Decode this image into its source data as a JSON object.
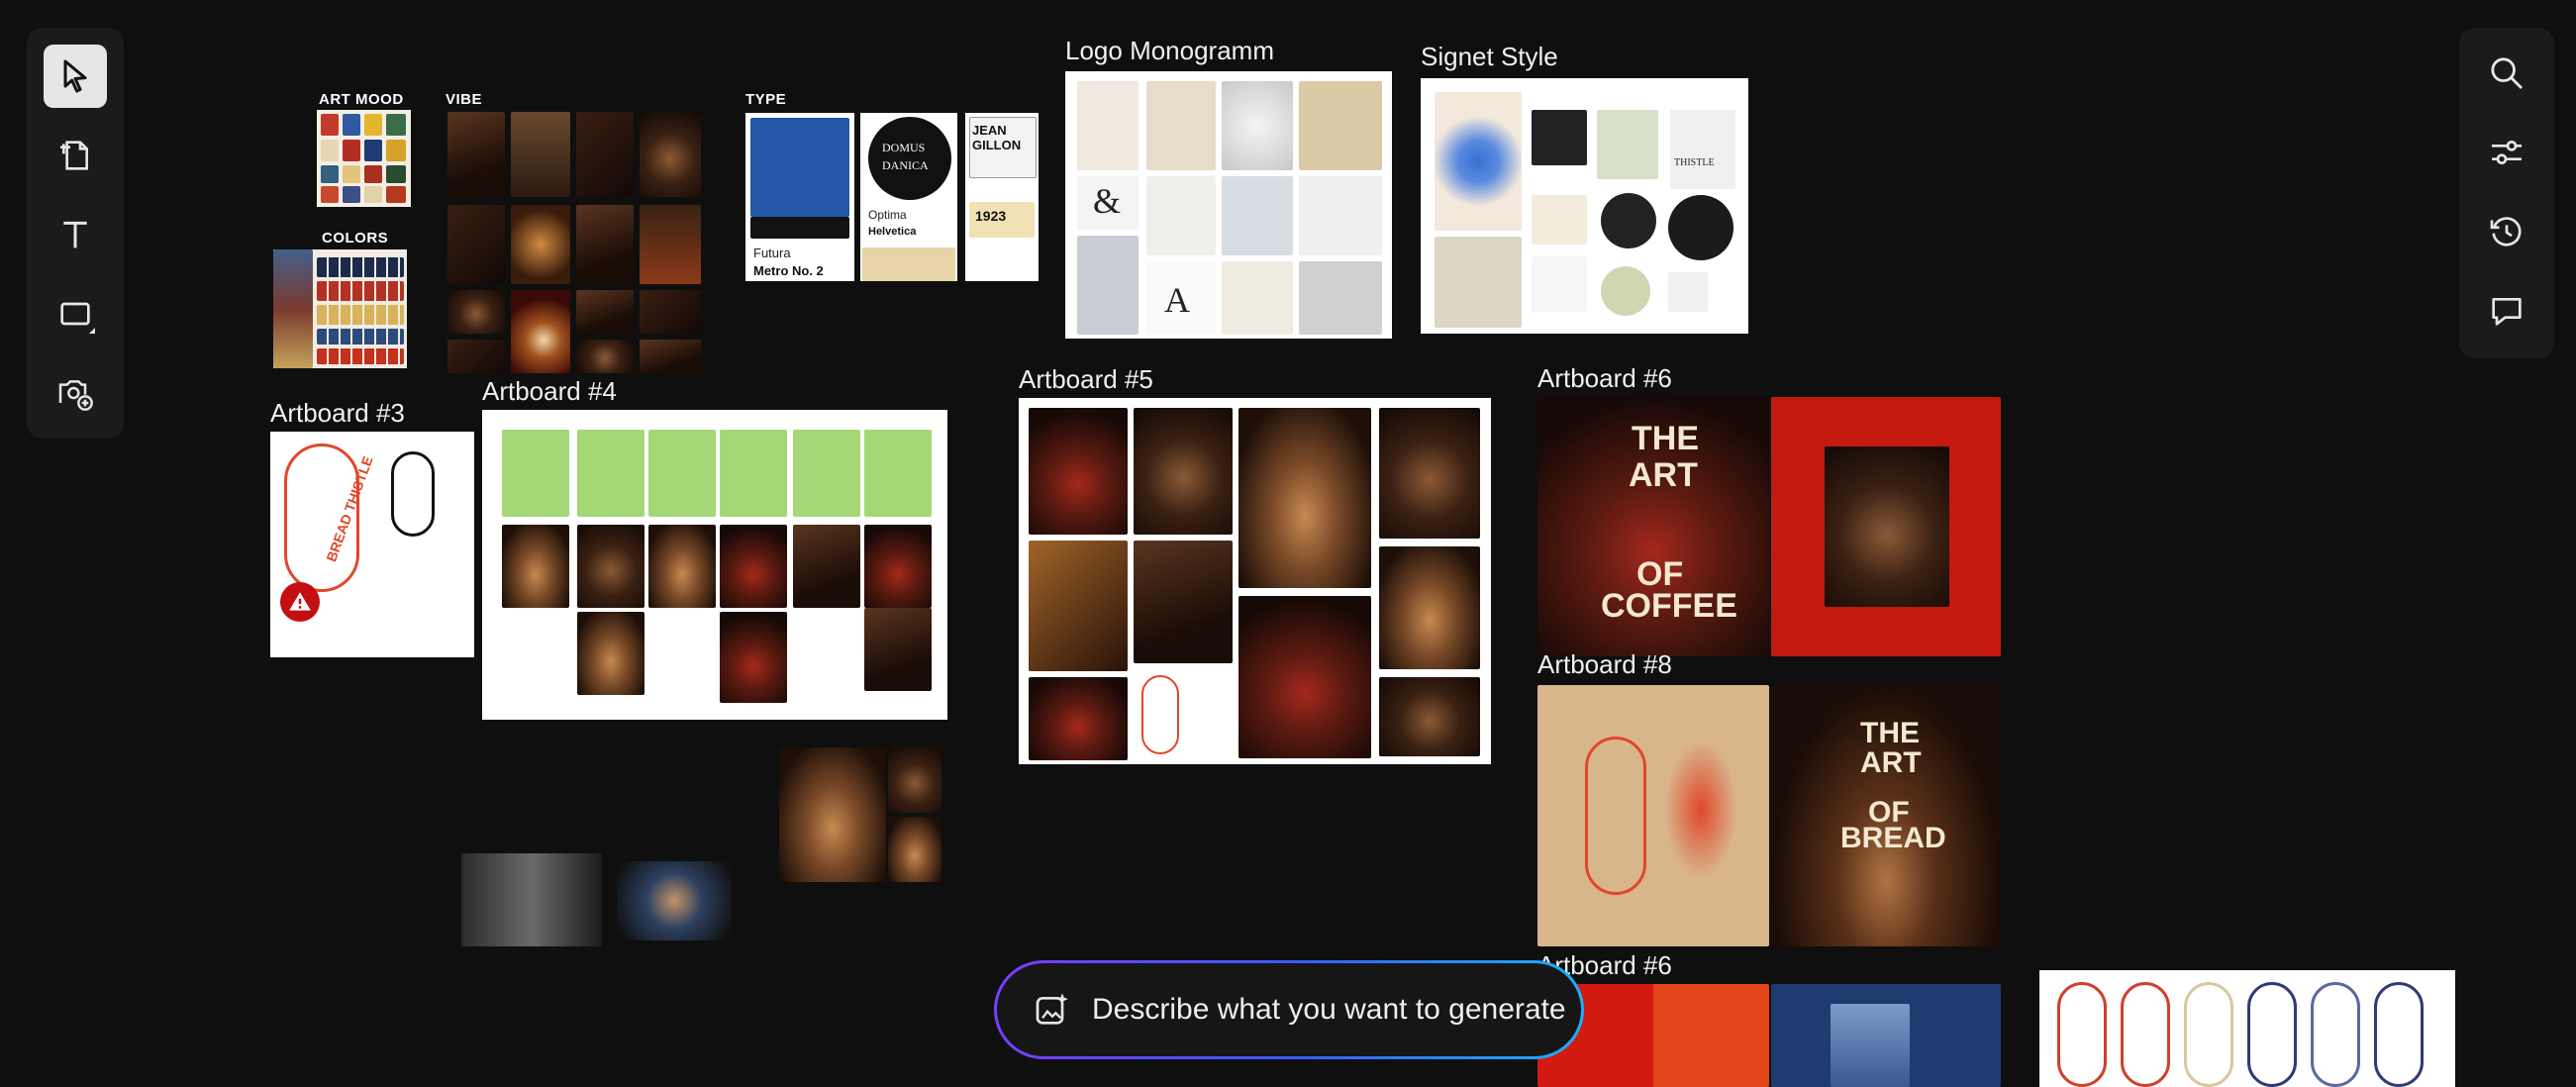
{
  "left_toolbar": {
    "tools": [
      "select-tool",
      "artboard-tool",
      "text-tool",
      "shape-tool",
      "image-tool"
    ]
  },
  "right_toolbar": {
    "tools": [
      "search",
      "adjustments",
      "history",
      "comments"
    ]
  },
  "moodboard": {
    "art_mood": "ART MOOD",
    "vibe": "VIBE",
    "colors": "COLORS",
    "type": "TYPE"
  },
  "type_samples": {
    "domus_1": "DOMUS",
    "domus_2": "DANICA",
    "jean": "JEAN GILLON",
    "futura": "Futura",
    "metro": "Metro No. 2",
    "optima": "Optima",
    "helvetica": "Helvetica",
    "year": "1923"
  },
  "artboards": {
    "logo_monogramm": "Logo Monogramm",
    "signet_style": "Signet Style",
    "a3": "Artboard #3",
    "a4": "Artboard #4",
    "a5": "Artboard #5",
    "a6_top": "Artboard #6",
    "a8": "Artboard #8",
    "a6_bottom": "Artboard #6"
  },
  "poster_text": {
    "art_of_coffee": [
      "THE",
      "ART",
      "OF",
      "COFFEE"
    ],
    "art_of_bread": [
      "THE",
      "ART",
      "OF",
      "BREAD"
    ],
    "bread_thistle": "BREAD THISTLE"
  },
  "generate": {
    "placeholder": "Describe what you want to generate"
  },
  "colors": {
    "accent_gradient": [
      "#7b3cff",
      "#3b5bff",
      "#1bb0ff"
    ],
    "brand_red": "#c4190f",
    "logo_orange": "#e0472a"
  }
}
